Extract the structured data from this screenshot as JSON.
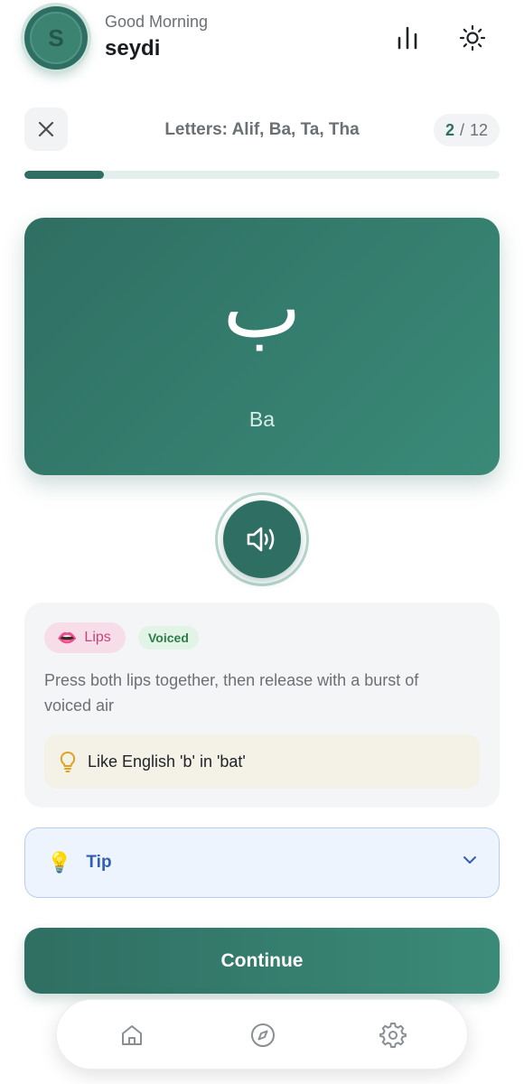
{
  "header": {
    "avatar_initial": "S",
    "greeting": "Good Morning",
    "username": "seydi",
    "icons": [
      "stats-icon",
      "sun-icon"
    ]
  },
  "lesson": {
    "title": "Letters: Alif, Ba, Ta, Tha",
    "current": "2",
    "separator": "/",
    "total": "12",
    "progress_fraction": 0.167
  },
  "letter": {
    "arabic": "ب",
    "transliteration": "Ba"
  },
  "articulation": {
    "place_emoji": "👄",
    "place_label": "Lips",
    "voicing_label": "Voiced",
    "description": "Press both lips together, then release with a burst of voiced air",
    "comparison": "Like English 'b' in 'bat'"
  },
  "tip": {
    "emoji": "💡",
    "label": "Tip"
  },
  "continue_label": "Continue",
  "nav": {
    "items": [
      "home-icon",
      "compass-icon",
      "settings-icon"
    ]
  },
  "colors": {
    "primary": "#2f6f63",
    "primary_light": "#3a8a78",
    "tip_blue": "#2e5fb3",
    "lips_pink": "#c2457f",
    "voiced_green": "#2e7d4a"
  }
}
